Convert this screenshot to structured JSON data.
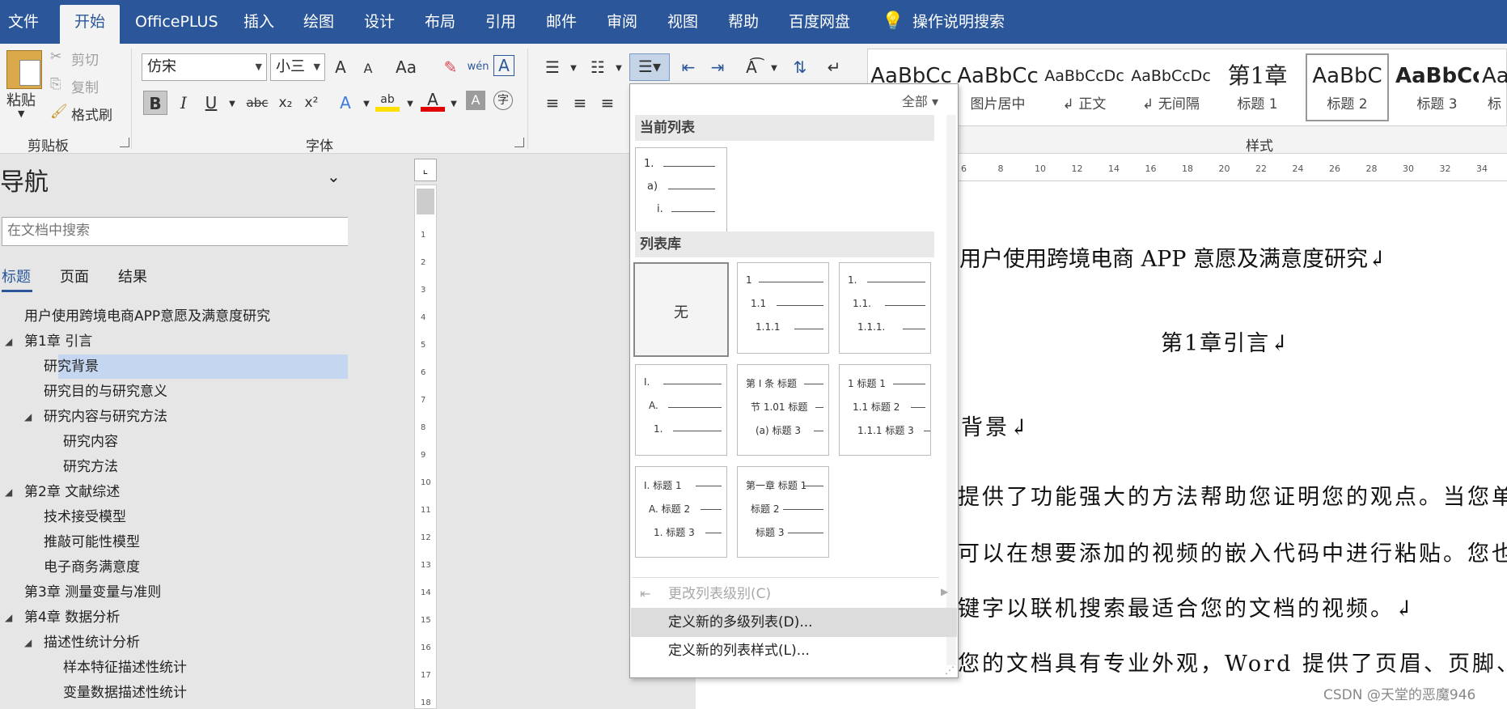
{
  "menubar": {
    "tabs": [
      "文件",
      "开始",
      "OfficePLUS",
      "插入",
      "绘图",
      "设计",
      "布局",
      "引用",
      "邮件",
      "审阅",
      "视图",
      "帮助",
      "百度网盘"
    ],
    "active_tab": "开始",
    "search": "操作说明搜索"
  },
  "clipboard": {
    "paste": "粘贴",
    "cut": "剪切",
    "copy": "复制",
    "format_painter": "格式刷",
    "label": "剪贴板"
  },
  "font": {
    "name": "仿宋",
    "size": "小三",
    "label": "字体",
    "grow": "A",
    "shrink": "A",
    "case": "Aa",
    "bold": "B",
    "italic": "I",
    "underline": "U",
    "strike": "abc",
    "sub": "x₂",
    "sup": "x²",
    "phonetic": "wén",
    "enclose": "A",
    "effects": "A",
    "highlight": "ab",
    "fontcolor": "A",
    "shade": "A",
    "circle": "字"
  },
  "styles": {
    "label": "样式",
    "items": [
      {
        "preview": "AaBbCc",
        "name": ""
      },
      {
        "preview": "AaBbCc",
        "name": "图片居中"
      },
      {
        "preview": "AaBbCcDc",
        "name": "↲ 正文"
      },
      {
        "preview": "AaBbCcDc",
        "name": "↲ 无间隔"
      },
      {
        "preview": "第1章",
        "name": "标题 1"
      },
      {
        "preview": "AaBbC",
        "name": "标题 2"
      },
      {
        "preview": "AaBbCc",
        "name": "标题 3"
      },
      {
        "preview": "Aa",
        "name": "标"
      }
    ]
  },
  "navigation": {
    "title": "导航",
    "search_placeholder": "在文档中搜索",
    "tabs": [
      "标题",
      "页面",
      "结果"
    ],
    "items": [
      {
        "text": "用户使用跨境电商APP意愿及满意度研究",
        "level": 0,
        "expand": false,
        "selected": false
      },
      {
        "text": "第1章 引言",
        "level": 0,
        "expand": true,
        "selected": false
      },
      {
        "text": "研究背景",
        "level": 1,
        "expand": false,
        "selected": true
      },
      {
        "text": "研究目的与研究意义",
        "level": 1,
        "expand": false,
        "selected": false
      },
      {
        "text": "研究内容与研究方法",
        "level": 1,
        "expand": true,
        "selected": false
      },
      {
        "text": "研究内容",
        "level": 2,
        "expand": false,
        "selected": false
      },
      {
        "text": "研究方法",
        "level": 2,
        "expand": false,
        "selected": false
      },
      {
        "text": "第2章 文献综述",
        "level": 0,
        "expand": true,
        "selected": false
      },
      {
        "text": "技术接受模型",
        "level": 1,
        "expand": false,
        "selected": false
      },
      {
        "text": "推敲可能性模型",
        "level": 1,
        "expand": false,
        "selected": false
      },
      {
        "text": "电子商务满意度",
        "level": 1,
        "expand": false,
        "selected": false
      },
      {
        "text": "第3章 测量变量与准则",
        "level": 0,
        "expand": false,
        "selected": false
      },
      {
        "text": "第4章 数据分析",
        "level": 0,
        "expand": true,
        "selected": false
      },
      {
        "text": "描述性统计分析",
        "level": 1,
        "expand": true,
        "selected": false
      },
      {
        "text": "样本特征描述性统计",
        "level": 2,
        "expand": false,
        "selected": false
      },
      {
        "text": "变量数据描述性统计",
        "level": 2,
        "expand": false,
        "selected": false
      }
    ]
  },
  "ruler": {
    "marks": [
      "6",
      "8",
      "10",
      "12",
      "14",
      "16",
      "18",
      "20",
      "22",
      "24",
      "26",
      "28",
      "30",
      "32",
      "34"
    ],
    "vmarks": [
      "1",
      "2",
      "3",
      "4",
      "5",
      "6",
      "7",
      "8",
      "9",
      "10",
      "11",
      "12",
      "13",
      "14",
      "15",
      "16",
      "17",
      "18"
    ]
  },
  "document": {
    "title": "用户使用跨境电商 APP 意愿及满意度研究↲",
    "chapter": "第1章引言↲",
    "section": "背景↲",
    "lines": [
      "提供了功能强大的方法帮助您证明您的观点。当您单",
      "可以在想要添加的视频的嵌入代码中进行粘贴。您也",
      "键字以联机搜索最适合您的文档的视频。↲",
      "您的文档具有专业外观，Word 提供了页眉、页脚、"
    ]
  },
  "dropdown": {
    "filter": "全部",
    "current_header": "当前列表",
    "library_header": "列表库",
    "none_label": "无",
    "current": [
      "1.",
      "a)",
      "i."
    ],
    "tiles": [
      [
        "1",
        "1.1",
        "1.1.1"
      ],
      [
        "1.",
        "1.1.",
        "1.1.1."
      ],
      [
        "I.",
        "A.",
        "1."
      ],
      [
        "第 Ⅰ 条 标题",
        "节 1.01 标题",
        "(a) 标题 3"
      ],
      [
        "1 标题 1",
        "1.1 标题 2",
        "1.1.1 标题 3"
      ],
      [
        "I. 标题 1",
        "A. 标题 2",
        "1. 标题 3"
      ],
      [
        "第一章 标题 1",
        "标题 2",
        "标题 3"
      ]
    ],
    "menu": [
      {
        "label": "更改列表级别(C)",
        "disabled": true
      },
      {
        "label": "定义新的多级列表(D)...",
        "disabled": false,
        "highlighted": true
      },
      {
        "label": "定义新的列表样式(L)...",
        "disabled": false
      }
    ]
  },
  "watermark": "CSDN @天堂的恶魔946"
}
